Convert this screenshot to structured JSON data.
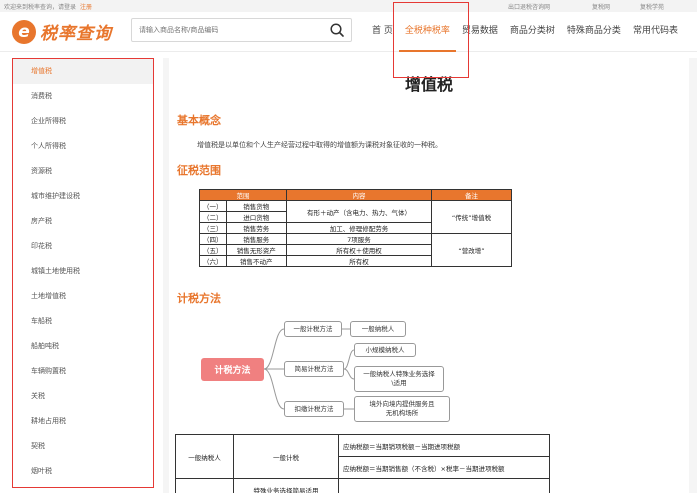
{
  "topbar": {
    "welcome": "欢迎来到税率查询，请登录",
    "register": "注册",
    "links": [
      "出口退税咨询网",
      "复税网",
      "复税学苑"
    ]
  },
  "header": {
    "logo_text": "税率查询",
    "search_placeholder": "请输入商品名称/商品编码"
  },
  "nav": {
    "items": [
      "首 页",
      "全税种税率",
      "贸易数据",
      "商品分类树",
      "特殊商品分类",
      "常用代码表"
    ],
    "active_index": 1
  },
  "sidebar": {
    "items": [
      "增值税",
      "消费税",
      "企业所得税",
      "个人所得税",
      "资源税",
      "城市维护建设税",
      "房产税",
      "印花税",
      "城镇土地使用税",
      "土地增值税",
      "车船税",
      "船舶吨税",
      "车辆购置税",
      "关税",
      "耕地占用税",
      "契税",
      "烟叶税"
    ],
    "active_index": 0
  },
  "article": {
    "title": "增值税",
    "section_concept": "基本概念",
    "concept_text": "增值税是以单位和个人生产经营过程中取得的增值额为课税对象征收的一种税。",
    "section_scope": "征税范围",
    "section_method": "计税方法"
  },
  "scope_table": {
    "headers": [
      "范围",
      "内容",
      "备注"
    ],
    "rows": [
      {
        "num": "（一）",
        "scope": "销售货物"
      },
      {
        "num": "（二）",
        "scope": "进口货物"
      },
      {
        "num": "（三）",
        "scope": "销售劳务",
        "content": "加工、修理修配劳务"
      },
      {
        "num": "（四）",
        "scope": "销售服务",
        "content": "7项服务"
      },
      {
        "num": "（五）",
        "scope": "销售无形资产",
        "content": "所有权＋使用权"
      },
      {
        "num": "（六）",
        "scope": "销售不动产",
        "content": "所有权"
      }
    ],
    "merged_content_1": "有形＋动产（含电力、热力、气体）",
    "note_1": "“传统”增值税",
    "note_2": "“营改增”"
  },
  "diagram": {
    "root": "计税方法",
    "general": "一般计税方法",
    "general_leaf": "一般纳税人",
    "simple": "简易计税方法",
    "simple_leaf_1": "小规模纳税人",
    "simple_leaf_2": "一般纳税人特殊业务选择\\适用",
    "withhold": "扣缴计税方法",
    "withhold_leaf": "境外向境内提供服务且无机构场所"
  },
  "formula_table": {
    "taxpayer": "一般纳税人",
    "method": "一般计税",
    "formula_1": "应纳税额＝当期销项税额－当期进项税额",
    "formula_2": "应纳税额＝当期销售额（不含税）×税率－当期进项税额",
    "cut_text": "特殊业务选择简易适用"
  },
  "colors": {
    "accent": "#e8762d",
    "annotation": "#e53935",
    "root_node": "#f08080"
  }
}
